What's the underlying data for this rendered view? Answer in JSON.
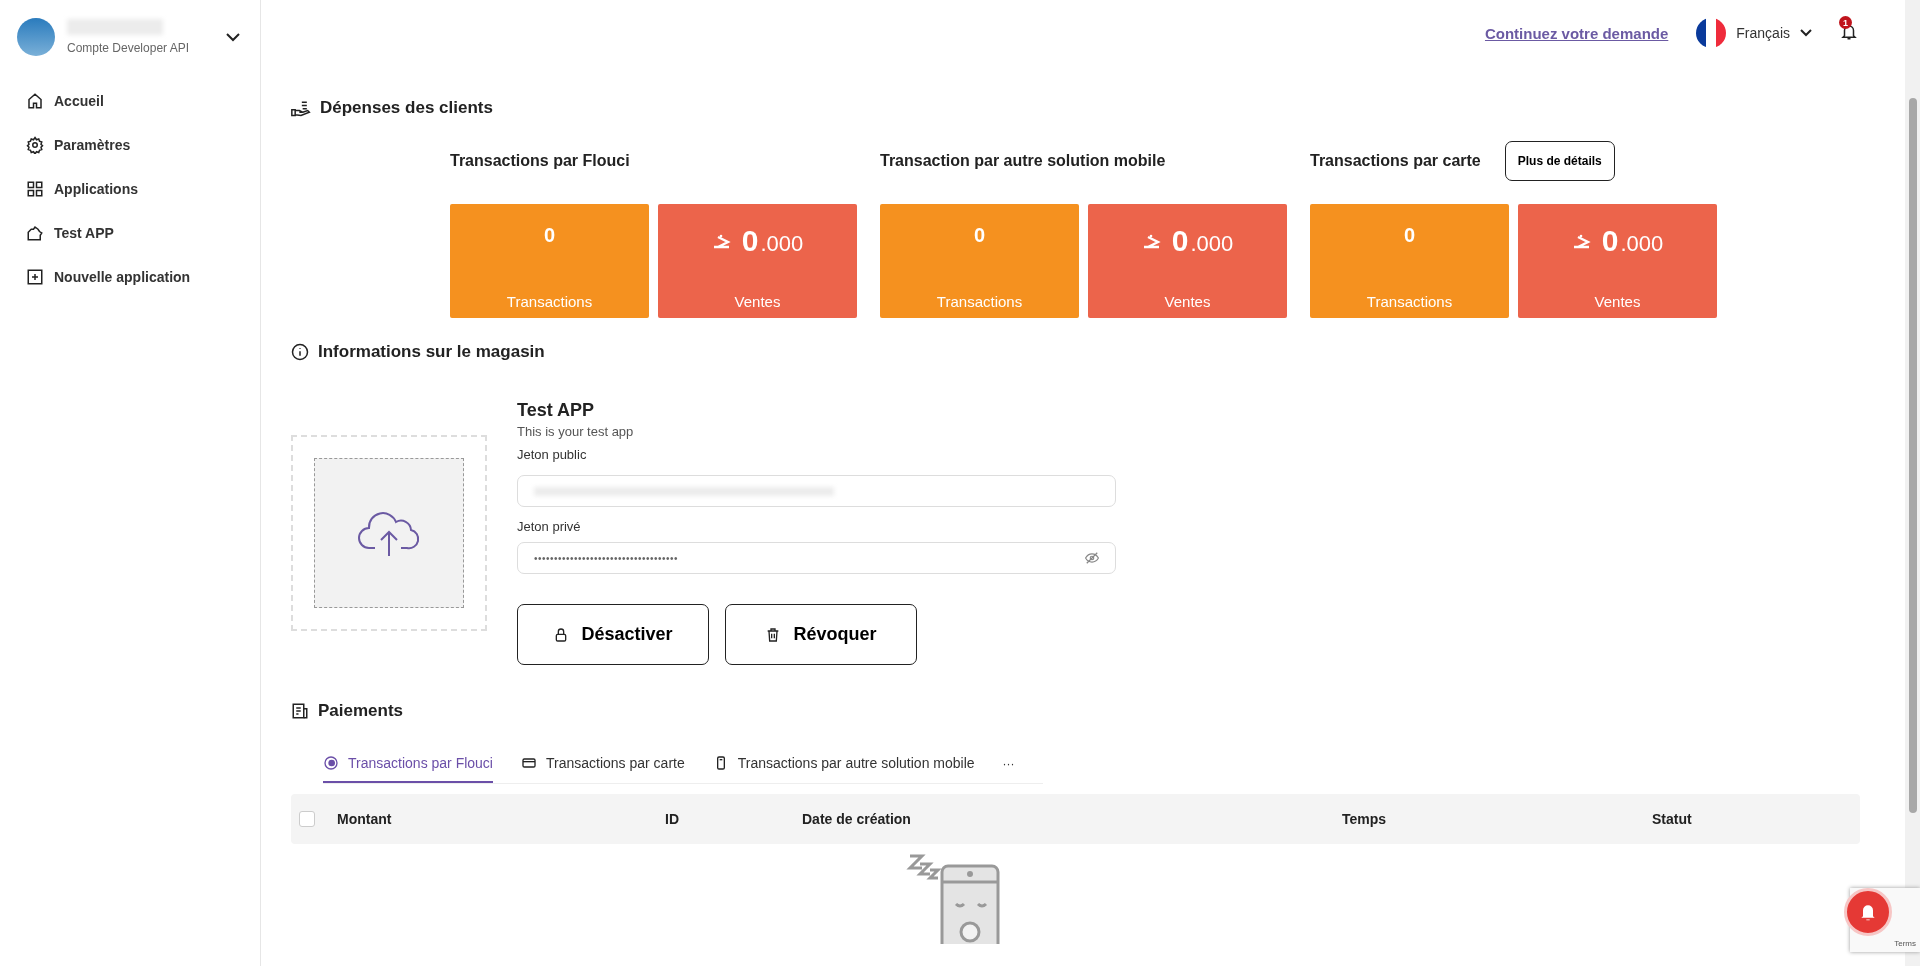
{
  "account": {
    "subtitle": "Compte Developer API"
  },
  "sidebar": {
    "items": [
      {
        "label": "Accueil",
        "selected": false
      },
      {
        "label": "Paramètres",
        "selected": false
      },
      {
        "label": "Applications",
        "selected": false
      },
      {
        "label": "Test APP",
        "selected": false
      },
      {
        "label": "Nouvelle application",
        "selected": false
      }
    ]
  },
  "topbar": {
    "link": "Continuez votre demande",
    "language": "Français",
    "notifications": "1"
  },
  "spending": {
    "title": "Dépenses des clients",
    "details_button": "Plus de détails",
    "groups": [
      {
        "title": "Transactions par Flouci",
        "count": "0",
        "count_label": "Transactions",
        "amount": "0",
        "decimals": ".000",
        "amount_label": "Ventes"
      },
      {
        "title": "Transaction par autre solution mobile",
        "count": "0",
        "count_label": "Transactions",
        "amount": "0",
        "decimals": ".000",
        "amount_label": "Ventes"
      },
      {
        "title": "Transactions par carte",
        "count": "0",
        "count_label": "Transactions",
        "amount": "0",
        "decimals": ".000",
        "amount_label": "Ventes"
      }
    ]
  },
  "store": {
    "title": "Informations sur le magasin",
    "app_name": "Test APP",
    "description": "This is your test app",
    "public_token_label": "Jeton public",
    "private_token_label": "Jeton privé",
    "private_token": "••••••••••••••••••••••••••••••••••••",
    "buttons": [
      "Désactiver",
      "Révoquer"
    ]
  },
  "payments": {
    "title": "Paiements",
    "tabs": [
      {
        "label": "Transactions par Flouci",
        "selected": true
      },
      {
        "label": "Transactions par carte",
        "selected": false
      },
      {
        "label": "Transactions par autre solution mobile",
        "selected": false
      }
    ],
    "more": "···",
    "table": {
      "select_all_checked": false,
      "columns": [
        "Montant",
        "ID",
        "Date de création",
        "Temps",
        "Statut"
      ]
    }
  },
  "recaptcha": {
    "text": "Terms"
  }
}
